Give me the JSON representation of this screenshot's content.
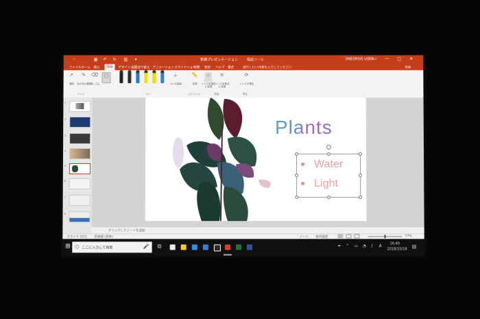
{
  "titlebar": {
    "document_title": "新規プレゼンテーション",
    "context_tab": "描画ツール",
    "user": "ONEDRIVE USER"
  },
  "tabs": [
    "ファイル",
    "ホーム",
    "挿入",
    "描画",
    "デザイン",
    "画面切り替え",
    "アニメーション",
    "スライドショー",
    "校閲",
    "表示",
    "ヘルプ",
    "書式"
  ],
  "active_tab_index": 3,
  "tell_me": "実行したい作業を入力してください",
  "share": "共有",
  "ribbon": {
    "tools": [
      {
        "label": "選択",
        "icon": "pointer-icon"
      },
      {
        "label": "なげなわ選択",
        "icon": "lasso-icon"
      },
      {
        "label": "消しゴム",
        "icon": "eraser-icon"
      },
      {
        "label": "ペンの追加",
        "icon": "add-pen-icon"
      },
      {
        "label": "定規",
        "icon": "ruler-icon"
      },
      {
        "label": "インクを図形に変換",
        "icon": "ink-to-shape-icon"
      },
      {
        "label": "インクを数式に変換",
        "icon": "ink-to-math-icon"
      },
      {
        "label": "インクの再生",
        "icon": "ink-replay-icon"
      }
    ],
    "pens": [
      "#222222",
      "#2b2b2b",
      "#2f6fd6",
      "#f2e017",
      "#f5d414",
      "#3a7bd5"
    ],
    "groups": [
      "ツール",
      "ペン",
      "ステンシル",
      "変換",
      "再生"
    ]
  },
  "thumbnails": [
    {
      "num": "1"
    },
    {
      "num": "2"
    },
    {
      "num": "3"
    },
    {
      "num": "4"
    },
    {
      "num": "5"
    },
    {
      "num": "6"
    },
    {
      "num": "7"
    },
    {
      "num": "8"
    }
  ],
  "selected_thumbnail": 4,
  "slide": {
    "title": "Plants",
    "bullets": [
      "Water",
      "Light"
    ]
  },
  "notes_placeholder": "クリックしてノートを追加",
  "status": {
    "slide_info": "スライド 5/11",
    "language": "日本語 (日本)",
    "notes": "ノート",
    "comments": "表示設定",
    "zoom": "77%"
  },
  "taskbar": {
    "search_placeholder": "ここに入力して検索",
    "time": "16:40",
    "date": "2018/10/18"
  }
}
